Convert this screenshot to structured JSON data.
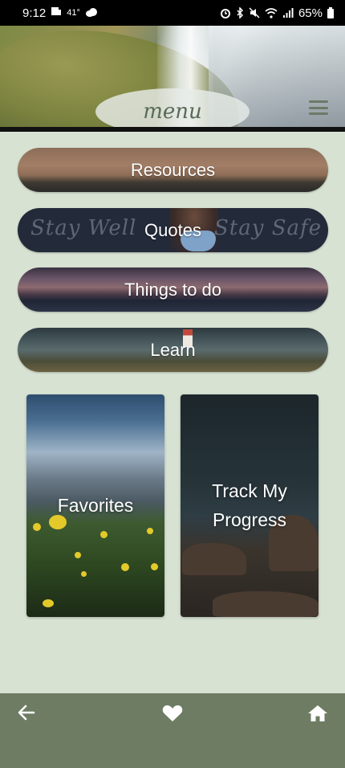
{
  "status_bar": {
    "time": "9:12",
    "temperature": "41°",
    "battery": "65%"
  },
  "header": {
    "menu_label": "menu"
  },
  "buttons": [
    {
      "label": "Resources"
    },
    {
      "label": "Quotes",
      "script_left": "Stay Well",
      "script_right": "Stay Safe"
    },
    {
      "label": "Things to do"
    },
    {
      "label": "Learn"
    }
  ],
  "cards": [
    {
      "label": "Favorites"
    },
    {
      "label": "Track My Progress"
    }
  ],
  "colors": {
    "background": "#d7e2d3",
    "nav_bar": "#6e7c63",
    "menu_text": "#5b6a58"
  },
  "icons": {
    "back": "back-arrow-icon",
    "favorites": "heart-icon",
    "home": "home-icon",
    "menu": "hamburger-menu-icon"
  }
}
